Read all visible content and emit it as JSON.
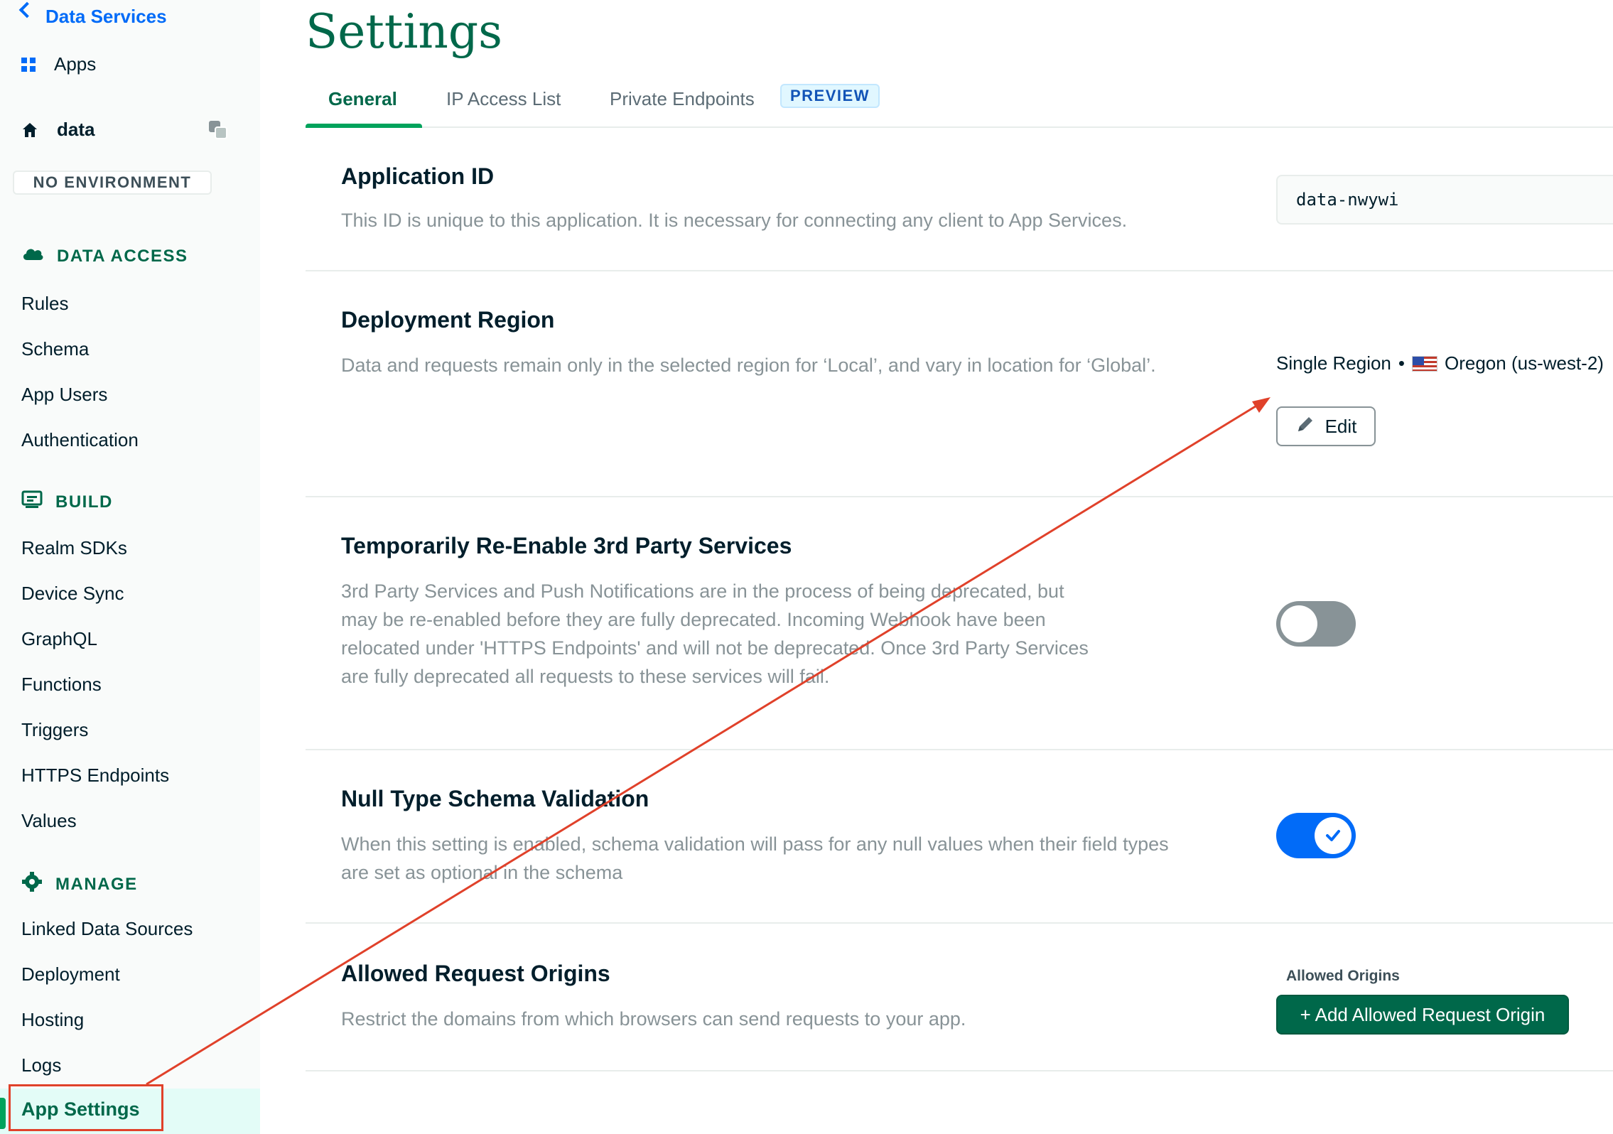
{
  "sidebar": {
    "back_label": "Data Services",
    "apps_label": "Apps",
    "app_name": "data",
    "environment_badge": "NO ENVIRONMENT",
    "sections": [
      {
        "title": "DATA ACCESS",
        "icon": "cloud-icon",
        "items": [
          "Rules",
          "Schema",
          "App Users",
          "Authentication"
        ]
      },
      {
        "title": "BUILD",
        "icon": "build-icon",
        "items": [
          "Realm SDKs",
          "Device Sync",
          "GraphQL",
          "Functions",
          "Triggers",
          "HTTPS Endpoints",
          "Values"
        ]
      },
      {
        "title": "MANAGE",
        "icon": "gear-icon",
        "items": [
          "Linked Data Sources",
          "Deployment",
          "Hosting",
          "Logs"
        ]
      }
    ],
    "active_item": "App Settings"
  },
  "main": {
    "title": "Settings",
    "tabs": [
      {
        "label": "General",
        "active": true
      },
      {
        "label": "IP Access List",
        "active": false
      },
      {
        "label": "Private Endpoints",
        "active": false,
        "badge": "PREVIEW"
      }
    ],
    "settings": {
      "application_id": {
        "title": "Application ID",
        "description": "This ID is unique to this application. It is necessary for connecting any client to App Services.",
        "value": "data-nwywi"
      },
      "deployment_region": {
        "title": "Deployment Region",
        "description": "Data and requests remain only in the selected region for ‘Local’, and vary in location for ‘Global’.",
        "mode": "Single Region",
        "separator": "•",
        "region": "Oregon (us-west-2)",
        "edit_label": "Edit"
      },
      "third_party": {
        "title": "Temporarily Re-Enable 3rd Party Services",
        "description_lines": [
          "3rd Party Services and Push Notifications are in the process of being deprecated, but",
          "may be re-enabled before they are fully deprecated. Incoming Webhook have been",
          "relocated under 'HTTPS Endpoints' and will not be deprecated. Once 3rd Party Services",
          "are fully deprecated all requests to these services will fail."
        ],
        "enabled": false
      },
      "null_type": {
        "title": "Null Type Schema Validation",
        "description_lines": [
          "When this setting is enabled, schema validation will pass for any null values when their field types",
          "are set as optional in the schema"
        ],
        "enabled": true
      },
      "allowed_origins": {
        "title": "Allowed Request Origins",
        "description": "Restrict the domains from which browsers can send requests to your app.",
        "list_label": "Allowed Origins",
        "add_button": "+ Add Allowed Request Origin"
      }
    }
  },
  "colors": {
    "brand_green": "#00684a",
    "accent_blue": "#016bf8",
    "annotation_red": "#e0412a",
    "active_bg": "#e3fcf7"
  }
}
